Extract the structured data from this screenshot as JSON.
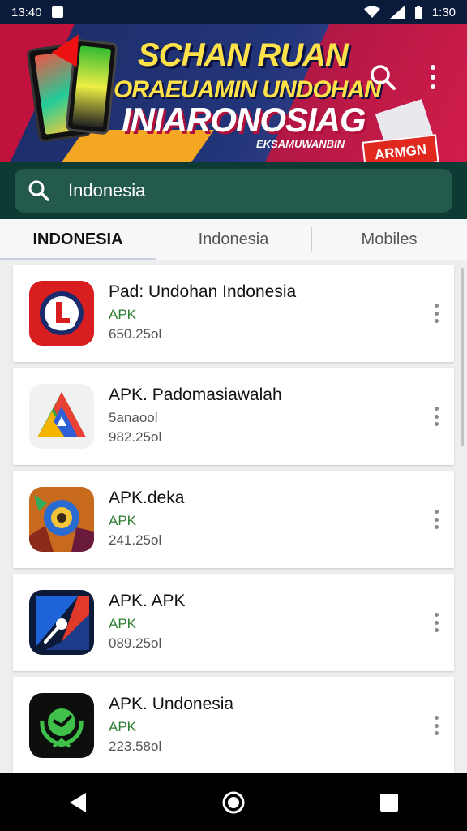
{
  "status_bar": {
    "time_left": "13:40",
    "time_right": "1:30"
  },
  "banner": {
    "line1": "SCHAN RUAN",
    "line2": "ORAEUAMIN UNDOHAN",
    "line3": "INIARONOSIAG",
    "line4": "EKSAMUWANBIN",
    "badge": "ARMGN",
    "search_icon": "search-icon",
    "menu_icon": "more-vert-icon"
  },
  "search": {
    "value": "Indonesia",
    "icon": "search-icon"
  },
  "tabs": [
    {
      "label": "INDONESIA",
      "active": true
    },
    {
      "label": "Indonesia",
      "active": false
    },
    {
      "label": "Mobiles",
      "active": false
    }
  ],
  "apps": [
    {
      "name": "Pad: Undohan Indonesia",
      "type": "APK",
      "size": "650.25ol",
      "icon": "red-shield-icon"
    },
    {
      "name": "APK. Padomasiawalah",
      "type": "5anaool",
      "size": "982.25ol",
      "icon": "colorful-triangle-icon"
    },
    {
      "name": "APK.deka",
      "type": "APK",
      "size": "241.25ol",
      "icon": "game-art-icon"
    },
    {
      "name": "APK. APK",
      "type": "APK",
      "size": "089.25ol",
      "icon": "pin-tool-icon"
    },
    {
      "name": "APK. Undonesia",
      "type": "APK",
      "size": "223.58ol",
      "icon": "green-emblem-icon"
    }
  ],
  "navigation": {
    "back": "back-icon",
    "home": "home-icon",
    "recents": "recents-icon"
  }
}
